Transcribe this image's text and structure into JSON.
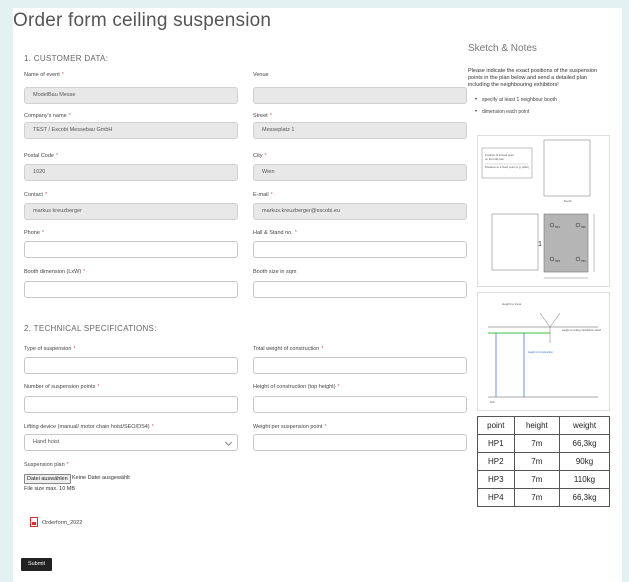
{
  "title": "Order form ceiling suspension",
  "sections": {
    "customer": "1. CUSTOMER DATA:",
    "technical": "2. TECHNICAL SPECIFICATIONS:"
  },
  "customer": {
    "event_label": "Name of event",
    "event_value": "ModelBau Messe",
    "venue_label": "Venue",
    "venue_value": "",
    "company_label": "Company's name",
    "company_value": "TEST / Escobi Messebau GmbH",
    "street_label": "Street",
    "street_value": "Messeplatz 1",
    "postal_label": "Postal Code",
    "postal_value": "1020",
    "city_label": "City",
    "city_value": "Wien",
    "contact_label": "Contact",
    "contact_value": "markus kreuzberger",
    "email_label": "E-mail",
    "email_value": "markus.kreuzberger@escobi.eu",
    "phone_label": "Phone",
    "phone_value": "",
    "hall_label": "Hall & Stand no.",
    "hall_value": "",
    "booth_dim_label": "Booth dimension (LxW)",
    "booth_dim_value": "",
    "booth_size_label": "Booth size in sqm",
    "booth_size_value": ""
  },
  "technical": {
    "type_label": "Type of suspension",
    "type_value": "",
    "total_weight_label": "Total weight of construction",
    "total_weight_value": "",
    "points_label": "Number of suspension points",
    "points_value": "",
    "height_label": "Height of construction (top height)",
    "height_value": "",
    "lifting_label": "Lifting device (manual/ motor chain hoist/SEO/DS4)",
    "lifting_value": "Hand hoist",
    "weight_point_label": "Weight per suspension point",
    "weight_point_value": "",
    "plan_label": "Suspension plan",
    "file_button": "Datei auswählen",
    "file_status": "Keine Datei ausgewählt",
    "file_hint": "File size max. 10 MB",
    "attachment": "Orderform_2022"
  },
  "submit_label": "Submit",
  "sidebar": {
    "title": "Sketch & Notes",
    "text": "Please indicate the exact positions of the suspension points in the plan below and send a detailed plan including the neighbouring exhibitors!",
    "bullets": [
      "specify at least 1 neighbour booth",
      "dimension each point"
    ]
  },
  "sketch1": {
    "note_lines": [
      "Position of a fixed point",
      "on the hall plan",
      "Distance to a fixed point (e.g. pillar)"
    ],
    "booth_label": "booth",
    "points": [
      "HP1",
      "HP2",
      "HP3",
      "HP4"
    ]
  },
  "sketch2": {
    "heading": "Height to truss",
    "label_right": "Height of ceiling / Exhibition stand",
    "label_blue": "Height of construction",
    "floor_label": "floor"
  },
  "points_table": {
    "headers": [
      "point",
      "height",
      "weight"
    ],
    "rows": [
      [
        "HP1",
        "7m",
        "66,3kg"
      ],
      [
        "HP2",
        "7m",
        "90kg"
      ],
      [
        "HP3",
        "7m",
        "110kg"
      ],
      [
        "HP4",
        "7m",
        "66,3kg"
      ]
    ]
  },
  "colors": {
    "page_bg": "#e4f1f3",
    "required": "#d45b5b",
    "submit_bg": "#222222"
  }
}
